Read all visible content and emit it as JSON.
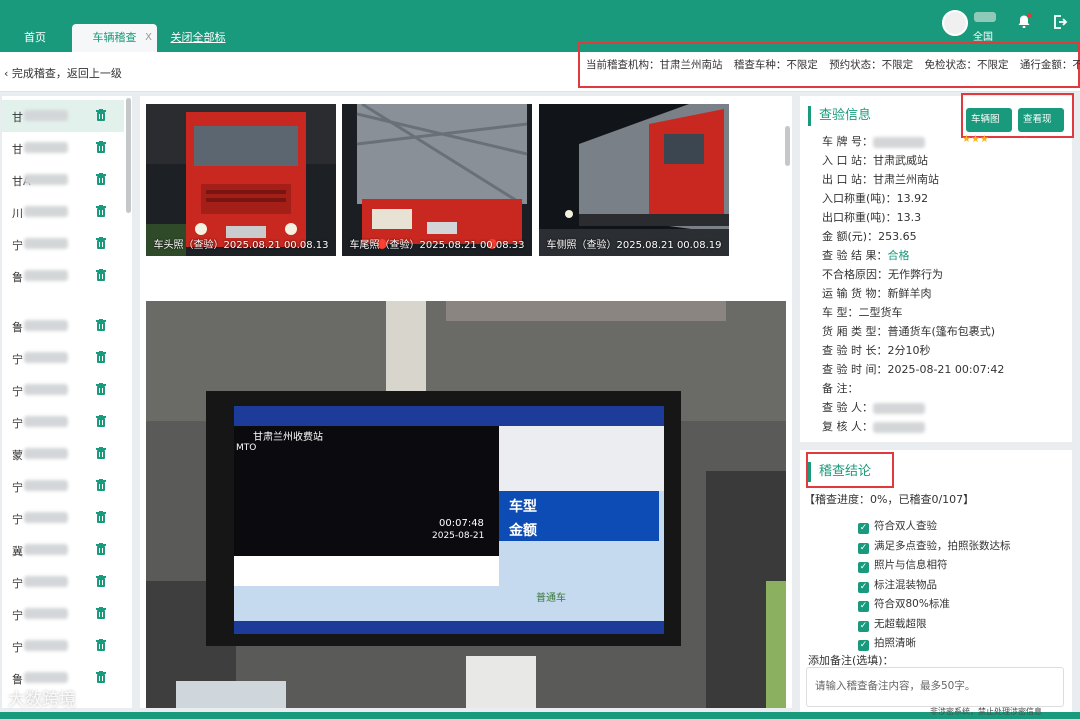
{
  "tabs": {
    "home": "首页",
    "active": "车辆稽查",
    "active_close": "X",
    "close_all": "关闭全部标签"
  },
  "user": {
    "role": "全国"
  },
  "subbar": {
    "back": "完成稽查，返回上一级"
  },
  "filters": [
    "当前稽查机构：甘肃兰州南站",
    "稽查车种：不限定",
    "预约状态：不限定",
    "免检状态：不限定",
    "通行金额：不限定"
  ],
  "vehicles": [
    {
      "prefix": "甘"
    },
    {
      "prefix": "甘"
    },
    {
      "prefix": "甘A"
    },
    {
      "prefix": "川"
    },
    {
      "prefix": "宁"
    },
    {
      "prefix": "鲁"
    },
    {
      "prefix": "鲁"
    },
    {
      "prefix": "宁"
    },
    {
      "prefix": "宁"
    },
    {
      "prefix": "宁"
    },
    {
      "prefix": "蒙"
    },
    {
      "prefix": "宁"
    },
    {
      "prefix": "宁"
    },
    {
      "prefix": "冀"
    },
    {
      "prefix": "宁"
    },
    {
      "prefix": "宁"
    },
    {
      "prefix": "宁"
    },
    {
      "prefix": "鲁"
    }
  ],
  "photos": [
    {
      "caption": "车头照（查验）2025.08.21 00.08.13"
    },
    {
      "caption": "车尾照（查验）2025.08.21 00.08.33"
    },
    {
      "caption": "车侧照（查验）2025.08.21 00.08.19"
    }
  ],
  "main_photo": {
    "station": "甘肃兰州收费站",
    "mto": "MTO",
    "time": "00:07:48",
    "date": "2025-08-21",
    "label_type": "车型",
    "label_amount": "金额",
    "cargo": "普通车"
  },
  "info": {
    "title": "查验信息",
    "btn_map": "车辆图像",
    "btn_site": "查看现场",
    "stars": "★★★",
    "rows": [
      {
        "label": "车    牌    号：",
        "value": ""
      },
      {
        "label": "入    口    站：",
        "value": "甘肃武威站"
      },
      {
        "label": "出    口    站：",
        "value": "甘肃兰州南站"
      },
      {
        "label": "入口称重(吨)：",
        "value": "13.92"
      },
      {
        "label": "出口称重(吨)：",
        "value": "13.3"
      },
      {
        "label": "金         额(元)：",
        "value": "253.65"
      },
      {
        "label": "查 验 结 果：",
        "value": "合格"
      },
      {
        "label": "不合格原因：",
        "value": "无作弊行为"
      },
      {
        "label": "运 输 货 物：",
        "value": "新鲜羊肉"
      },
      {
        "label": "车         型：",
        "value": "二型货车"
      },
      {
        "label": "货 厢 类 型：",
        "value": "普通货车(篷布包裹式)"
      },
      {
        "label": "查 验 时 长：",
        "value": "2分10秒"
      },
      {
        "label": "查 验 时 间：",
        "value": "2025-08-21 00:07:42"
      },
      {
        "label": "备         注：",
        "value": ""
      },
      {
        "label": "查    验    人：",
        "value": ""
      },
      {
        "label": "复    核    人：",
        "value": ""
      }
    ]
  },
  "conclusion": {
    "title": "稽查结论",
    "progress": "【稽查进度：0%，已稽查0/107】",
    "checks": [
      "符合双人查验",
      "满足多点查验，拍照张数达标",
      "照片与信息相符",
      "标注混装物品",
      "符合双80%标准",
      "无超载超限",
      "拍照清晰"
    ],
    "remark_label": "添加备注(选填)：",
    "remark_placeholder": "请输入稽查备注内容，最多50字。"
  },
  "watermark": "大数跨境",
  "footer": "非涉密系统，禁止处理涉密信息",
  "colors": {
    "primary": "#1a9a7c",
    "highlight": "#e0393e",
    "star": "#f6b31a"
  }
}
